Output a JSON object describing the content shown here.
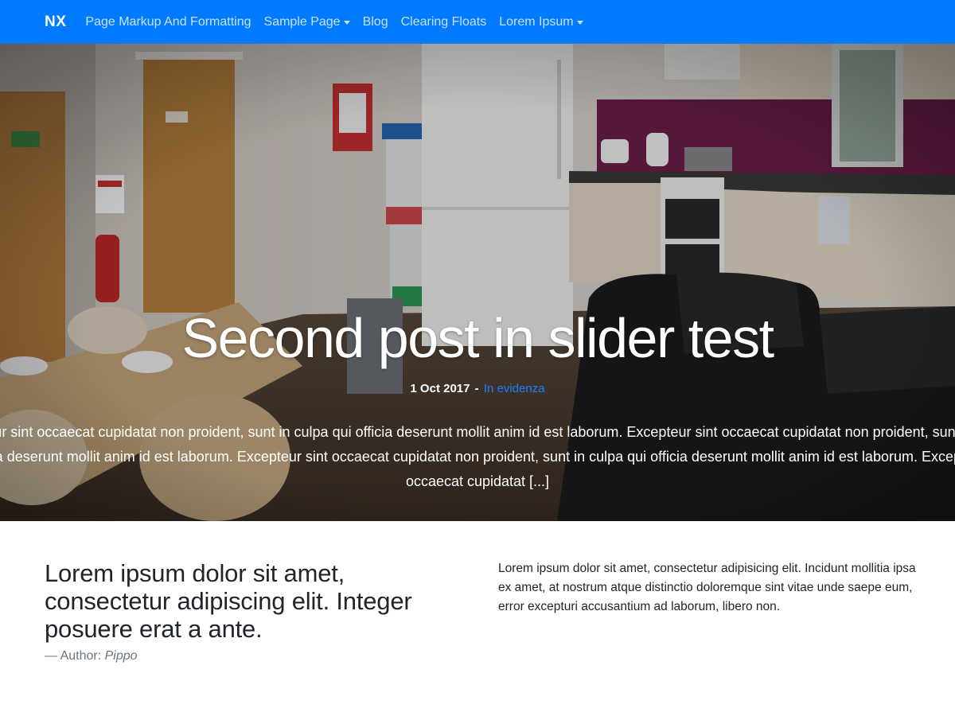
{
  "navbar": {
    "brand": "NX",
    "items": [
      {
        "label": "Page Markup And Formatting",
        "dropdown": false
      },
      {
        "label": "Sample Page",
        "dropdown": true
      },
      {
        "label": "Blog",
        "dropdown": false
      },
      {
        "label": "Clearing Floats",
        "dropdown": false
      },
      {
        "label": "Lorem Ipsum",
        "dropdown": true
      }
    ],
    "background_color": "#007bff"
  },
  "slider": {
    "title": "Second post in slider test",
    "date": "1 Oct 2017",
    "separator": "-",
    "category": "In evidenza",
    "excerpt": "Excepteur sint occaecat cupidatat non proident, sunt in culpa qui officia deserunt mollit anim id est laborum. Excepteur sint occaecat cupidatat non proident, sunt in culpa qui officia deserunt mollit anim id est laborum.  Excepteur sint occaecat cupidatat non proident, sunt in culpa qui officia deserunt mollit anim id est laborum.  Excepteur sint occaecat cupidatat [...]",
    "category_color": "#1e7bff"
  },
  "content": {
    "quote": "Lorem ipsum dolor sit amet, consectetur adipiscing elit. Integer posuere erat a ante.",
    "quote_footer_prefix": "— Author:",
    "quote_author": "Pippo",
    "paragraph": "Lorem ipsum dolor sit amet, consectetur adipisicing elit. Incidunt mollitia ipsa ex amet, at nostrum atque distinctio doloremque sint vitae unde saepe eum, error excepturi accusantium ad laborum, libero non."
  }
}
